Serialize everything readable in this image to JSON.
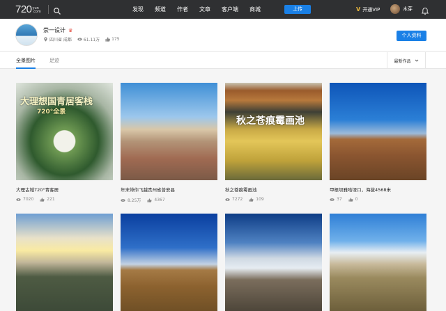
{
  "header": {
    "logo_num": "720",
    "logo_sub1": "yun",
    "logo_sub2": ".com",
    "nav": [
      "发现",
      "频道",
      "作者",
      "文章",
      "客户端",
      "商城"
    ],
    "upload_label": "上传",
    "vip_label": "开通VIP",
    "user_name": "木芽"
  },
  "profile": {
    "name": "崇一设计",
    "badge": "♛",
    "location": "四川省 成都",
    "views": "61.11万",
    "likes": "175",
    "info_button": "个人资料"
  },
  "tabs": {
    "items": [
      "全景图片",
      "足迹"
    ],
    "sort": "最新作品"
  },
  "cards": [
    {
      "title": "大理古城720°青客居",
      "views": "7020",
      "likes": "221",
      "overlay1": "大理想国青居客栈",
      "overlay2": "720°全景"
    },
    {
      "title": "年末带你飞越贵州省普安县",
      "views": "8.25万",
      "likes": "4367"
    },
    {
      "title": "秋之苍痕霉画池",
      "views": "7272",
      "likes": "109",
      "overlay1": "秋之苍痕霉画池"
    },
    {
      "title": "甲根坝雅哈垭口，海拔4568米",
      "views": "37",
      "likes": "0"
    },
    {
      "title": "",
      "views": "",
      "likes": ""
    },
    {
      "title": "",
      "views": "",
      "likes": ""
    },
    {
      "title": "",
      "views": "",
      "likes": ""
    },
    {
      "title": "",
      "views": "",
      "likes": ""
    }
  ],
  "colors": {
    "accent": "#1a80e6",
    "nav_bg": "#2f3032",
    "vip": "#e7b53d",
    "badge": "#e24c3f"
  }
}
